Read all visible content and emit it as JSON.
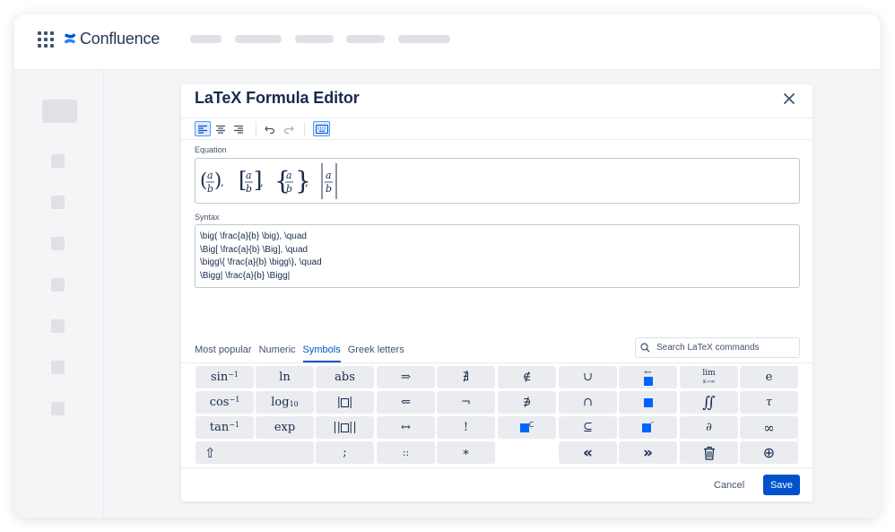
{
  "app": {
    "name": "Confluence"
  },
  "dialog": {
    "title": "LaTeX Formula Editor",
    "equation_label": "Equation",
    "syntax_label": "Syntax",
    "syntax_lines": [
      "\\big( \\frac{a}{b} \\big), \\quad",
      "\\Big[ \\frac{a}{b} \\Big], \\quad",
      "\\bigg\\{ \\frac{a}{b} \\bigg\\}, \\quad",
      "\\Bigg| \\frac{a}{b} \\Bigg|"
    ],
    "equation_render": {
      "frac_num": "a",
      "frac_den": "b",
      "pairs": [
        [
          "(",
          ")"
        ],
        [
          "[",
          "]"
        ],
        [
          "{",
          "}"
        ],
        [
          "|",
          "|"
        ]
      ],
      "sep": ","
    },
    "tabs": [
      {
        "label": "Most popular",
        "active": false
      },
      {
        "label": "Numeric",
        "active": false
      },
      {
        "label": "Symbols",
        "active": true
      },
      {
        "label": "Greek letters",
        "active": false
      }
    ],
    "search_placeholder": "Search LaTeX commands",
    "keys": {
      "sin": "sin",
      "cos": "cos",
      "tan": "tan",
      "inv": "−1",
      "ln": "ln",
      "log": "log",
      "log_base": "10",
      "exp": "exp",
      "abs": "abs",
      "implies": "⇒",
      "impliedby": "⇐",
      "iff": "↔",
      "nexists": "∄",
      "neg": "¬",
      "factorial": "!",
      "notin": "∉",
      "notni": "∌",
      "cup": "∪",
      "cap": "∩",
      "subseteq": "⊆",
      "overleftarrow": "←",
      "complement": "C",
      "dprime": "″",
      "lim": "lim",
      "lim_sub": "x→∞",
      "iint": "∬",
      "partial": "∂",
      "euler": "e",
      "tau": "τ",
      "infinity": "∞",
      "semicolon": ";",
      "colons": "::",
      "ast": "∗",
      "shift": "⇧",
      "prev": "«",
      "next": "»",
      "plus_circle": "⊕"
    },
    "cancel_label": "Cancel",
    "save_label": "Save"
  },
  "colors": {
    "brand": "#0052cc",
    "accent_blue": "#0065ff",
    "key_bg": "#ebecf0",
    "text": "#172b4d"
  }
}
